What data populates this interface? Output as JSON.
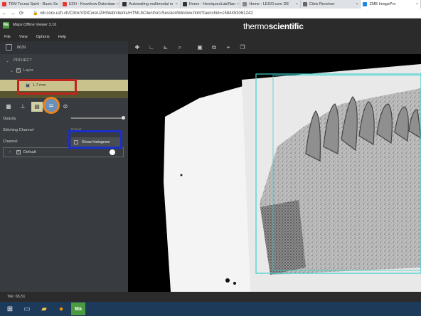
{
  "browser": {
    "tabs": [
      {
        "label": "TEM Tecnai Spirit - Basic Se",
        "fav_color": "#e53935"
      },
      {
        "label": "UZH - Knowhow Datenban",
        "fav_color": "#e53935"
      },
      {
        "label": "Automating multimodal m",
        "fav_color": "#333333"
      },
      {
        "label": "Home - HenriquesLab/Nan",
        "fav_color": "#333333"
      },
      {
        "label": "Home - LEGO.com DE",
        "fav_color": "#888888"
      },
      {
        "label": "Citrix Receiver",
        "fav_color": "#666666"
      },
      {
        "label": "ZMB ImagePro",
        "fav_color": "#1e88e5"
      }
    ],
    "url": "vdi.core.uzh.ch/Citrix/VDICoreUZHWeb/clients/HTML5Client/src/SessionWindow.html?launchid=1584453061242",
    "back_icon": "back-arrow-icon",
    "forward_icon": "forward-arrow-icon",
    "reload_icon": "reload-icon"
  },
  "app": {
    "logo_text": "Ma",
    "title": "Maps Offline Viewer 3.10",
    "brand_thin": "thermo",
    "brand_bold": "scientific",
    "menu": [
      "File",
      "View",
      "Options",
      "Help"
    ]
  },
  "toolbar": {
    "icons": [
      "plus-icon",
      "measure-angle-icon",
      "measure-icon",
      "zoom-icon",
      "layer-icon",
      "link-icon",
      "crosshair-icon",
      "clone-icon"
    ]
  },
  "panel": {
    "project_number": "8639",
    "project_label": "PROJECT",
    "layer_label": "Layer",
    "layer_item": "1.7 mm",
    "tabs": [
      "grid-icon",
      "pin-icon",
      "image-icon",
      "sliders-icon",
      "compass-icon"
    ],
    "opacity_label": "Opacity",
    "opacity_value": 1.0,
    "stitching_label": "Stitching Channel",
    "stitching_value": "Default",
    "channel_label": "Channel",
    "show_histogram": "Show histogram",
    "channel_default": "Default"
  },
  "status": {
    "tile": "Tile: 65,51"
  },
  "taskbar": {
    "items": [
      "windows-start-icon",
      "explorer-icon",
      "folder-icon",
      "firefox-icon",
      "maps-app-icon"
    ]
  },
  "colors": {
    "highlight_layer": "#c9c28d",
    "annotation_red": "#c0241c",
    "annotation_orange": "#e8841d",
    "annotation_blue": "#1a2fc9",
    "tile_outline": "#3fd0d0"
  }
}
